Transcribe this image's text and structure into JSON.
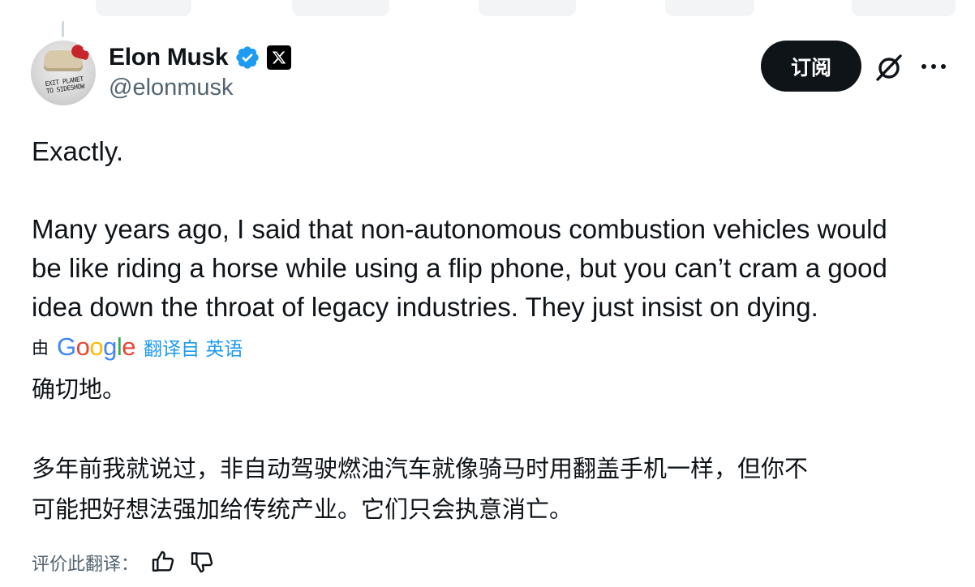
{
  "author": {
    "display_name": "Elon Musk",
    "handle": "@elonmusk",
    "avatar_scribble": "EXIT PLANET\nTO SIDESHOW"
  },
  "actions": {
    "subscribe_label": "订阅"
  },
  "tweet": {
    "paragraph_1": "Exactly.",
    "paragraph_2_line_1": "Many years ago, I said that non-autonomous combustion vehicles would",
    "paragraph_2_line_2": "be like riding a horse while using a flip phone, but you can’t cram a good",
    "paragraph_2_line_3": "idea down the throat of legacy industries. They just insist on dying."
  },
  "translation": {
    "by_label": "由",
    "google_letters": [
      "G",
      "o",
      "o",
      "g",
      "l",
      "e"
    ],
    "google_colors": [
      "#4285f4",
      "#ea4335",
      "#fbbc05",
      "#4285f4",
      "#34a853",
      "#ea4335"
    ],
    "translated_from_label": "翻译自 英语",
    "paragraph_1": "确切地。",
    "paragraph_2_line_1": "多年前我就说过，非自动驾驶燃油汽车就像骑马时用翻盖手机一样，但你不",
    "paragraph_2_line_2": "可能把好想法强加给传统产业。它们只会执意消亡。"
  },
  "rating": {
    "label": "评价此翻译："
  },
  "icons": {
    "verified": "verified-badge-icon",
    "x_affiliate": "x-logo-icon",
    "grok": "grok-icon",
    "more": "more-dots-icon",
    "thumbs_up": "thumbs-up-icon",
    "thumbs_down": "thumbs-down-icon"
  },
  "colors": {
    "text": "#0f1419",
    "secondary": "#536471",
    "accent": "#1d9bf0",
    "button_bg": "#0f1419"
  }
}
